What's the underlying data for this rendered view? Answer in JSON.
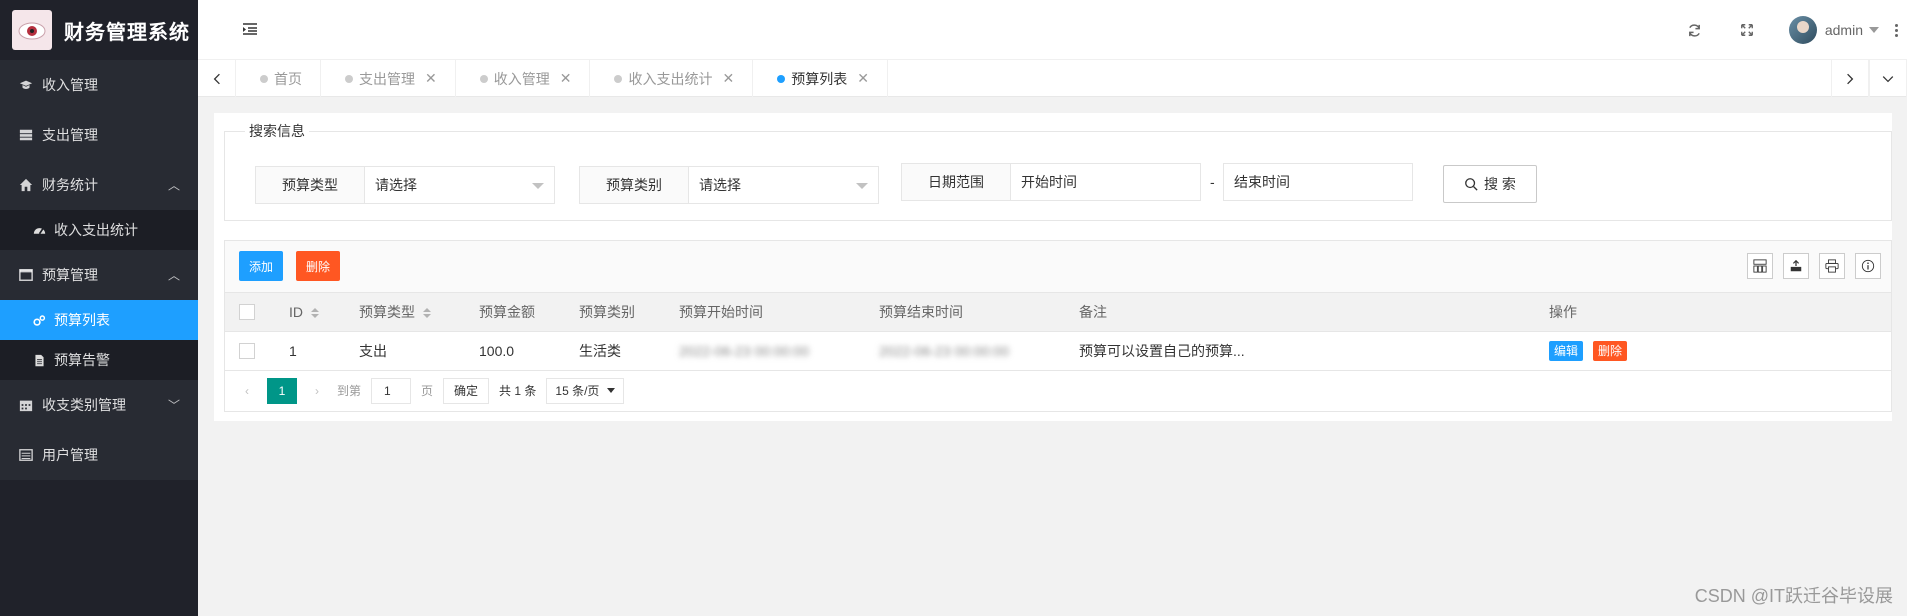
{
  "app": {
    "title": "财务管理系统"
  },
  "sidebar": {
    "items": [
      {
        "label": "收入管理",
        "icon": "graduation-cap-icon"
      },
      {
        "label": "支出管理",
        "icon": "server-icon"
      },
      {
        "label": "财务统计",
        "icon": "home-icon",
        "expanded": true,
        "children": [
          {
            "label": "收入支出统计",
            "icon": "dashboard-icon"
          }
        ]
      },
      {
        "label": "预算管理",
        "icon": "window-icon",
        "expanded": true,
        "children": [
          {
            "label": "预算列表",
            "icon": "gears-icon",
            "active": true
          },
          {
            "label": "预算告警",
            "icon": "file-icon"
          }
        ]
      },
      {
        "label": "收支类别管理",
        "icon": "calendar-icon",
        "expanded": false
      },
      {
        "label": "用户管理",
        "icon": "list-icon"
      }
    ]
  },
  "header": {
    "username": "admin"
  },
  "tabs": [
    {
      "label": "首页",
      "closable": false
    },
    {
      "label": "支出管理",
      "closable": true
    },
    {
      "label": "收入管理",
      "closable": true
    },
    {
      "label": "收入支出统计",
      "closable": true
    },
    {
      "label": "预算列表",
      "closable": true,
      "active": true
    }
  ],
  "search": {
    "legend": "搜索信息",
    "budget_type_label": "预算类型",
    "budget_type_value": "请选择",
    "budget_category_label": "预算类别",
    "budget_category_value": "请选择",
    "date_range_label": "日期范围",
    "start_placeholder": "开始时间",
    "end_placeholder": "结束时间",
    "separator": "-",
    "button": "搜 索"
  },
  "toolbar": {
    "add_label": "添加",
    "delete_label": "删除"
  },
  "table": {
    "columns": [
      "ID",
      "预算类型",
      "预算金额",
      "预算类别",
      "预算开始时间",
      "预算结束时间",
      "备注",
      "操作"
    ],
    "rows": [
      {
        "id": "1",
        "type": "支出",
        "amount": "100.0",
        "category": "生活类",
        "start": "2022-06-23 00:00:00",
        "end": "2022-06-23 00:00:00",
        "note": "预算可以设置自己的预算...",
        "edit": "编辑",
        "delete": "删除"
      }
    ]
  },
  "pager": {
    "current": "1",
    "goto_prefix": "到第",
    "goto_value": "1",
    "goto_suffix": "页",
    "confirm": "确定",
    "total": "共 1 条",
    "limit": "15 条/页"
  },
  "watermark": "CSDN @IT跃迁谷毕设展",
  "colors": {
    "primary": "#1e9fff",
    "danger": "#ff5722",
    "pager": "#009688",
    "sidebar": "#20222a"
  }
}
